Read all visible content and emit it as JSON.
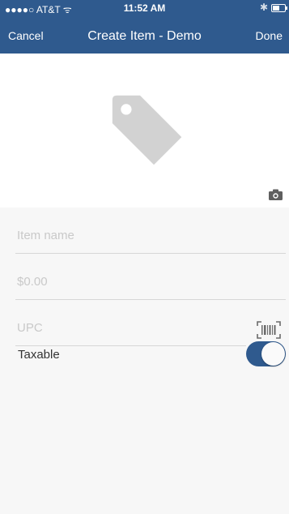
{
  "status_bar": {
    "carrier": "●●●●○ AT&T ᯤ",
    "time": "11:52 AM",
    "bluetooth": "✱",
    "battery_level": 0.5
  },
  "nav": {
    "cancel_label": "Cancel",
    "title": "Create Item - Demo",
    "done_label": "Done"
  },
  "image_area": {
    "placeholder_icon": "price-tag-icon",
    "camera_icon": "camera-icon"
  },
  "form": {
    "item_name": {
      "value": "",
      "placeholder": "Item name"
    },
    "price": {
      "value": "",
      "placeholder": "$0.00"
    },
    "upc": {
      "value": "",
      "placeholder": "UPC",
      "scan_icon": "barcode-scan-icon"
    },
    "taxable": {
      "label": "Taxable",
      "enabled": true
    }
  },
  "colors": {
    "header": "#2f5a8e",
    "toggle_on": "#2f5a8e",
    "background": "#f7f7f7"
  }
}
